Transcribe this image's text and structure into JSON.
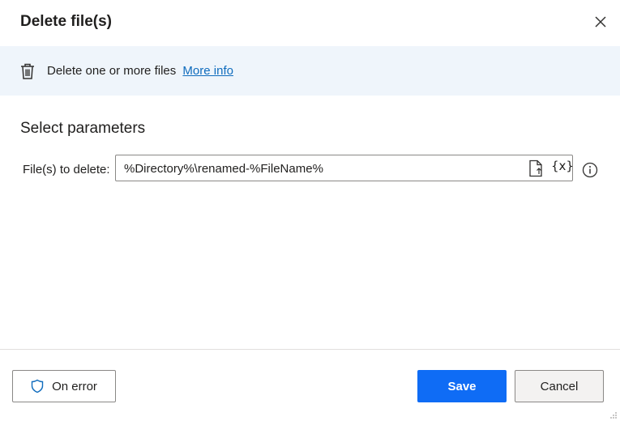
{
  "dialog": {
    "title": "Delete file(s)",
    "close_icon": "close-icon"
  },
  "banner": {
    "icon": "trash-icon",
    "text": "Delete one or more files",
    "link_text": "More info"
  },
  "parameters": {
    "section_title": "Select parameters",
    "files_to_delete": {
      "label": "File(s) to delete:",
      "value": "%Directory%\\renamed-%FileName%",
      "file_picker_icon": "file-picker-icon",
      "variable_picker_label": "{x}",
      "info_icon": "info-icon"
    }
  },
  "footer": {
    "on_error_label": "On error",
    "on_error_icon": "shield-icon",
    "save_label": "Save",
    "cancel_label": "Cancel"
  },
  "colors": {
    "accent": "#0f6cf5",
    "banner_bg": "#eff5fb",
    "link": "#0f6cbd"
  }
}
